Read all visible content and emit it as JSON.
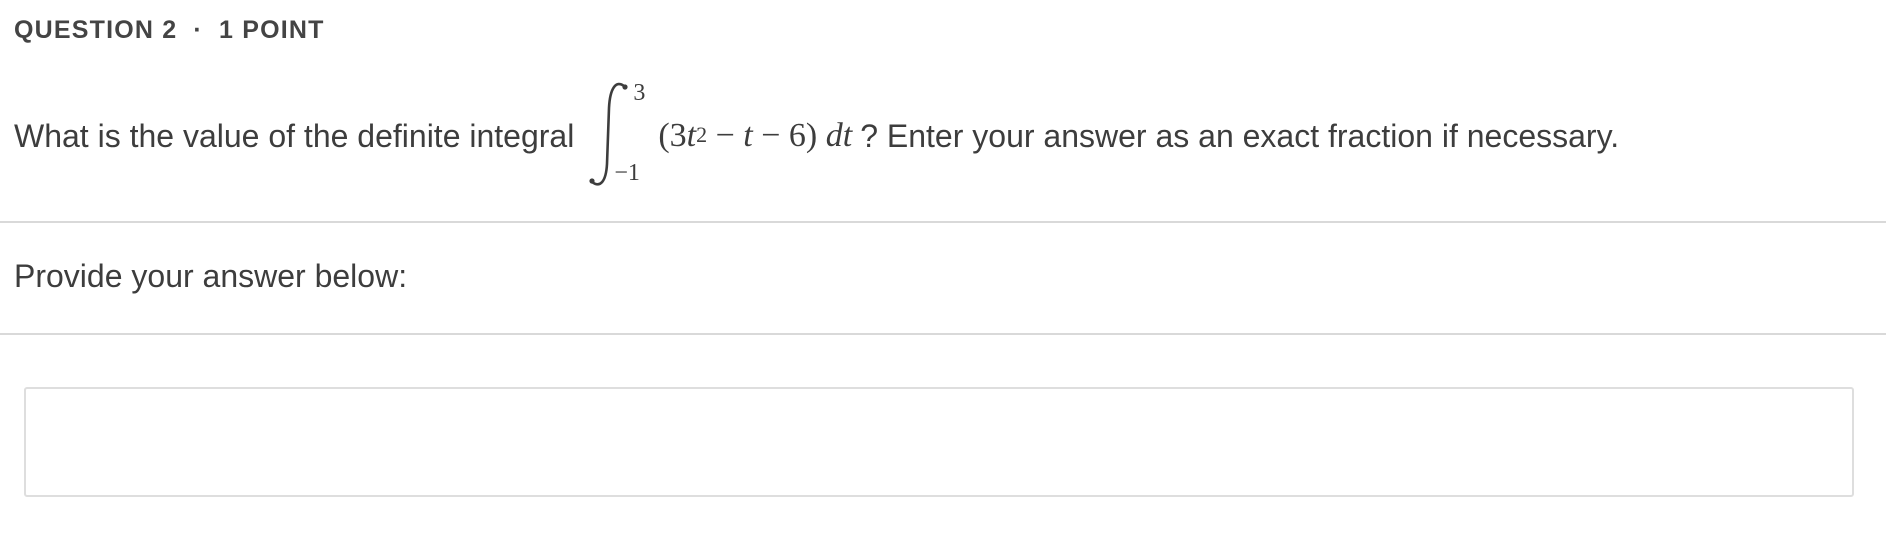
{
  "header": {
    "question_label": "QUESTION 2",
    "separator": "·",
    "points_label": "1 POINT"
  },
  "question": {
    "text_before": "What is the value of the definite integral",
    "integral": {
      "upper_limit": "3",
      "lower_limit": "−1",
      "integrand_open": "(3",
      "integrand_var1": "t",
      "integrand_exp": "2",
      "integrand_minus1": " − ",
      "integrand_var2": "t",
      "integrand_rest": " − 6) ",
      "differential": "dt"
    },
    "text_after": "? Enter your answer as an exact fraction if necessary."
  },
  "answer_section": {
    "prompt": "Provide your answer below:",
    "input_value": "",
    "input_placeholder": ""
  }
}
